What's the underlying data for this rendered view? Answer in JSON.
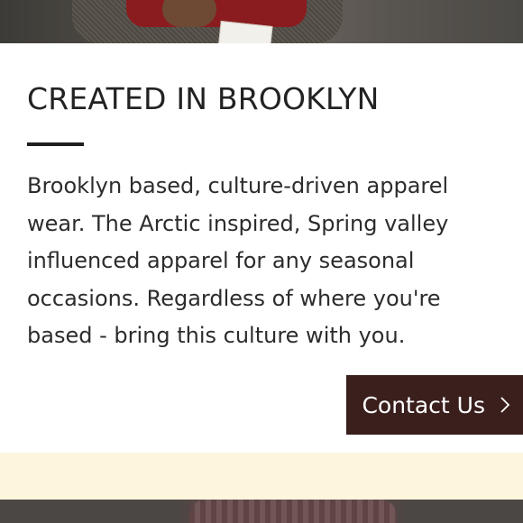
{
  "section": {
    "heading": "CREATED IN BROOKLYN",
    "body": "Brooklyn based, culture-driven apparel wear. The Arctic inspired, Spring valley influenced apparel for any seasonal occasions. Regardless of where you're based - bring this culture with you."
  },
  "cta": {
    "label": "Contact Us",
    "icon": "chevron-right-icon"
  },
  "colors": {
    "button_bg": "#3a1f1d",
    "band": "#fdf6dc",
    "divider": "#1f1f1f"
  }
}
